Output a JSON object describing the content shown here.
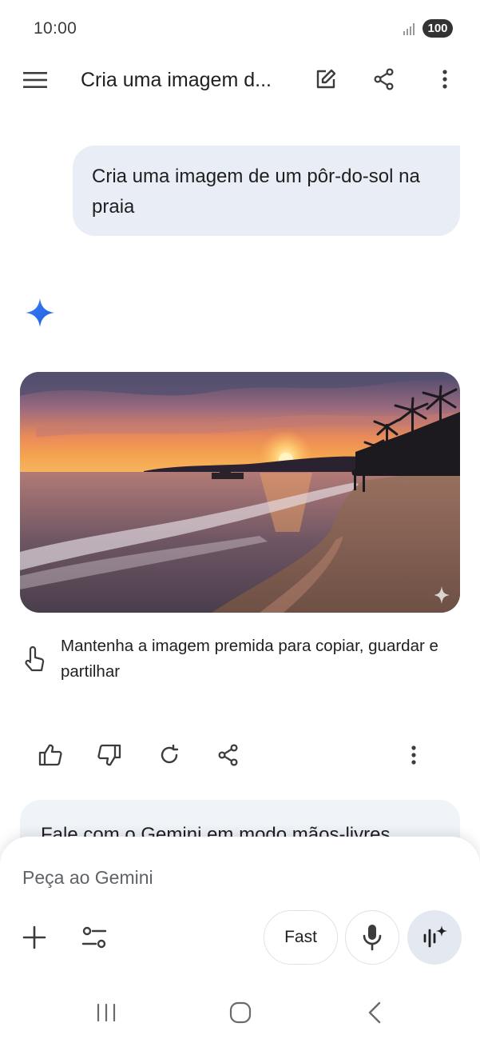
{
  "status_bar": {
    "time": "10:00",
    "battery": "100"
  },
  "app_bar": {
    "title": "Cria uma imagem d...",
    "icons": [
      "menu-icon",
      "edit-icon",
      "share-icon",
      "more-vert-icon"
    ]
  },
  "conversation": {
    "user_message": "Cria uma imagem de um pôr-do-sol na praia",
    "response": {
      "image_icon": "sparkle-icon",
      "hint_text": "Mantenha a imagem premida para copiar, guardar e partilhar",
      "actions": [
        "thumb-up-icon",
        "thumb-down-icon",
        "regenerate-icon",
        "share-icon",
        "more-vert-icon"
      ]
    },
    "handsfree_card": "Fale com o Gemini em modo mãos-livres"
  },
  "composer": {
    "placeholder": "Peça ao Gemini",
    "mode_label": "Fast",
    "icons": [
      "plus-icon",
      "tools-icon",
      "mic-icon",
      "live-icon"
    ]
  },
  "nav_bar": {
    "icons": [
      "recents-icon",
      "home-icon",
      "back-icon"
    ]
  },
  "colors": {
    "accent": "#4285f4",
    "bubble": "#e9eef6",
    "card": "#f0f4f9"
  }
}
